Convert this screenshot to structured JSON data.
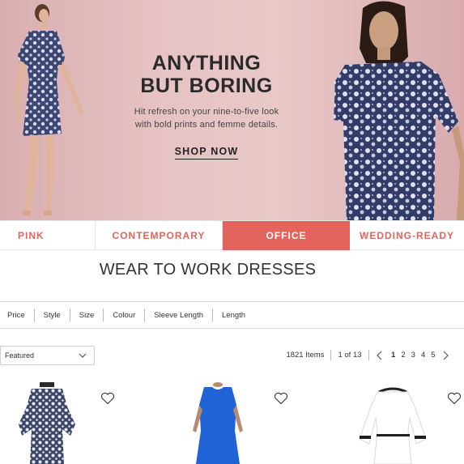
{
  "hero": {
    "title_line1": "ANYTHING",
    "title_line2": "BUT BORING",
    "subtitle_line1": "Hit refresh on your nine-to-five look",
    "subtitle_line2": "with bold prints and femme details.",
    "cta": "SHOP NOW",
    "background_color": "#e6c3c4"
  },
  "category_tabs": [
    {
      "label": "PINK",
      "active": false
    },
    {
      "label": "CONTEMPORARY",
      "active": false
    },
    {
      "label": "OFFICE",
      "active": true
    },
    {
      "label": "WEDDING-READY",
      "active": false
    }
  ],
  "page_title": "WEAR TO WORK DRESSES",
  "filters": [
    "Price",
    "Style",
    "Size",
    "Colour",
    "Sleeve Length",
    "Length"
  ],
  "sort": {
    "selected": "Featured"
  },
  "results": {
    "items": "1821 Items",
    "page_of": "1 of 13",
    "pages": [
      "1",
      "2",
      "3",
      "4",
      "5"
    ],
    "current_page": "1"
  },
  "products": [
    {
      "name": "floral print dress",
      "color": "#3e4a6b"
    },
    {
      "name": "blue sheath dress",
      "color": "#1f63d6"
    },
    {
      "name": "white dress with black trim",
      "color": "#ffffff"
    }
  ],
  "colors": {
    "accent": "#e2645c"
  },
  "icons": {
    "wishlist": "heart-outline-icon",
    "sort": "chevron-down-icon",
    "prev": "chevron-left-icon",
    "next": "chevron-right-icon"
  }
}
